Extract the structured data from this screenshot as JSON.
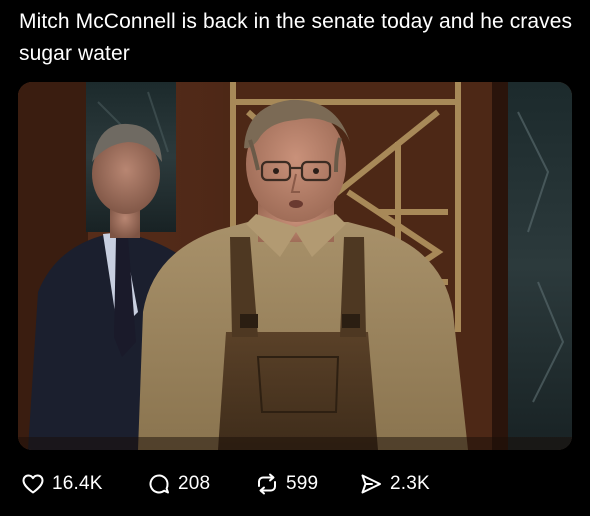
{
  "post": {
    "caption": "Mitch McConnell is back in the senate today and he craves sugar water",
    "image_description_icon": "photo"
  },
  "actions": {
    "likes": {
      "icon": "heart-icon",
      "count": "16.4K"
    },
    "comments": {
      "icon": "comment-bubble-icon",
      "count": "208"
    },
    "reposts": {
      "icon": "repost-icon",
      "count": "599"
    },
    "shares": {
      "icon": "send-icon",
      "count": "2.3K"
    }
  },
  "colors": {
    "background": "#000000",
    "text": "#ffffff"
  }
}
